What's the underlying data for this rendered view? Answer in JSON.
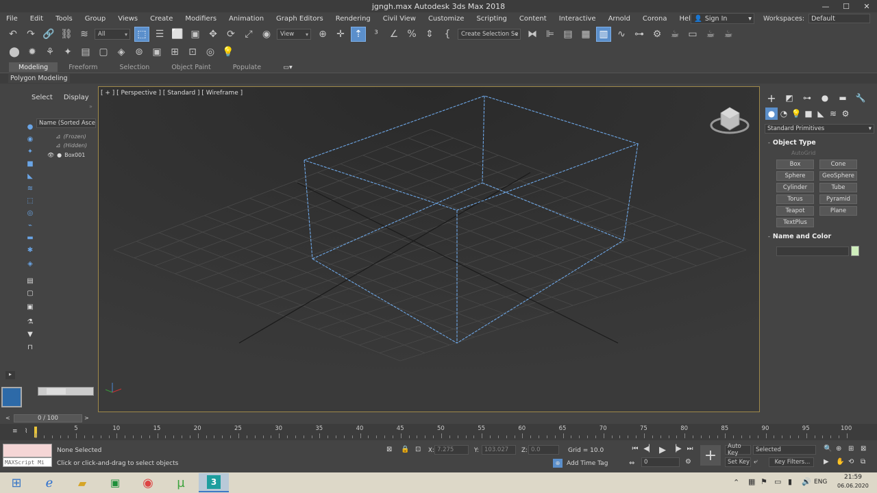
{
  "window": {
    "title": "jgngh.max   Autodesk 3ds Max 2018",
    "controls": [
      "—",
      "☐",
      "✕"
    ]
  },
  "menu": [
    "File",
    "Edit",
    "Tools",
    "Group",
    "Views",
    "Create",
    "Modifiers",
    "Animation",
    "Graph Editors",
    "Rendering",
    "Civil View",
    "Customize",
    "Scripting",
    "Content",
    "Interactive",
    "Arnold",
    "Corona",
    "Help"
  ],
  "account": {
    "signin": "Sign In",
    "workspaces_label": "Workspaces:",
    "workspace": "Default"
  },
  "toolbar": {
    "selection_filter": "All",
    "ref_coord": "View",
    "named_sel": "Create Selection Se"
  },
  "ribbon": {
    "tabs": [
      "Modeling",
      "Freeform",
      "Selection",
      "Object Paint",
      "Populate"
    ],
    "active_tab": "Modeling",
    "panel_label": "Polygon Modeling"
  },
  "scene_explorer": {
    "tab_select": "Select",
    "tab_display": "Display",
    "column": "Name (Sorted Ascending)",
    "rows": [
      "(Frozen)",
      "(Hidden)",
      "Box001"
    ]
  },
  "viewport": {
    "label": "[ + ] [ Perspective ] [ Standard ] [ Wireframe ]"
  },
  "command_panel": {
    "category": "Standard Primitives",
    "object_type_title": "Object Type",
    "autogrid": "AutoGrid",
    "buttons": [
      "Box",
      "Cone",
      "Sphere",
      "GeoSphere",
      "Cylinder",
      "Tube",
      "Torus",
      "Pyramid",
      "Teapot",
      "Plane",
      "TextPlus"
    ],
    "name_color_title": "Name and Color",
    "object_color": "#cfeebc"
  },
  "timeline": {
    "frame": "0 / 100",
    "ticks": [
      "0",
      "5",
      "10",
      "15",
      "20",
      "25",
      "30",
      "35",
      "40",
      "45",
      "50",
      "55",
      "60",
      "65",
      "70",
      "75",
      "80",
      "85",
      "90",
      "95",
      "100"
    ]
  },
  "status": {
    "maxscript": "MAXScript Mi",
    "selection": "None Selected",
    "prompt": "Click or click-and-drag to select objects",
    "x_label": "X:",
    "x": "7.275",
    "y_label": "Y:",
    "y": "103.027",
    "z_label": "Z:",
    "z": "0.0",
    "grid": "Grid = 10.0",
    "add_time_tag": "Add Time Tag",
    "auto_key": "Auto Key",
    "set_key": "Set Key",
    "key_mode": "Selected",
    "key_filters": "Key Filters...",
    "current_frame": "0"
  },
  "taskbar": {
    "lang": "ENG",
    "time": "21:59",
    "date": "06.06.2020"
  },
  "colors": {
    "accent": "#5b8fcb",
    "wireframe": "#6ea8e8",
    "viewport_border": "#a08a4a"
  }
}
